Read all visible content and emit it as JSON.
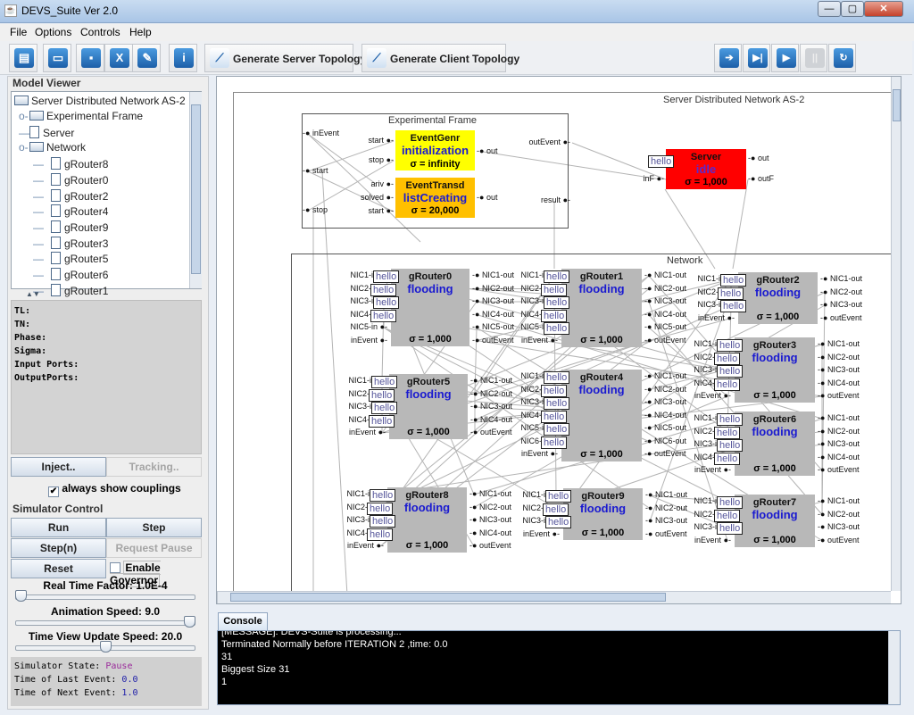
{
  "window": {
    "title": "DEVS_Suite Ver 2.0",
    "controls": [
      "—",
      "▢",
      "✕"
    ]
  },
  "menu": [
    "File",
    "Options",
    "Controls",
    "Help"
  ],
  "toolbar": {
    "icon_buttons": [
      {
        "icon": "new-document-icon",
        "glyph": "▤"
      },
      {
        "icon": "open-folder-icon",
        "glyph": "▭"
      },
      {
        "icon": "save-icon",
        "glyph": "▪"
      },
      {
        "icon": "export-icon",
        "glyph": "X"
      },
      {
        "icon": "wrench-icon",
        "glyph": "✎"
      },
      {
        "icon": "info-bubble-icon",
        "glyph": "i"
      }
    ],
    "generate_server": "Generate Server Topology",
    "generate_client": "Generate Client Topology",
    "sim_buttons": [
      {
        "icon": "step-arrow-icon",
        "glyph": "➔",
        "enabled": true
      },
      {
        "icon": "step-end-icon",
        "glyph": "▶|",
        "enabled": true
      },
      {
        "icon": "play-icon",
        "glyph": "▶",
        "enabled": true
      },
      {
        "icon": "pause-icon",
        "glyph": "||",
        "enabled": false
      },
      {
        "icon": "reset-icon",
        "glyph": "↻",
        "enabled": true
      }
    ]
  },
  "model_viewer": {
    "title": "Model Viewer",
    "root": "Server Distributed Network AS-2",
    "nodes": [
      {
        "label": "Experimental Frame",
        "type": "folder",
        "level": 1
      },
      {
        "label": "Server",
        "type": "leaf",
        "level": 1
      },
      {
        "label": "Network",
        "type": "folder",
        "level": 1
      },
      {
        "label": "gRouter8",
        "type": "leaf",
        "level": 2
      },
      {
        "label": "gRouter0",
        "type": "leaf",
        "level": 2
      },
      {
        "label": "gRouter2",
        "type": "leaf",
        "level": 2
      },
      {
        "label": "gRouter4",
        "type": "leaf",
        "level": 2
      },
      {
        "label": "gRouter9",
        "type": "leaf",
        "level": 2
      },
      {
        "label": "gRouter3",
        "type": "leaf",
        "level": 2
      },
      {
        "label": "gRouter5",
        "type": "leaf",
        "level": 2
      },
      {
        "label": "gRouter6",
        "type": "leaf",
        "level": 2
      },
      {
        "label": "gRouter1",
        "type": "leaf",
        "level": 2
      }
    ]
  },
  "info": [
    "TL:",
    "TN:",
    "Phase:",
    "Sigma:",
    "Input Ports:",
    "OutputPorts:"
  ],
  "inject": "Inject..",
  "tracking": "Tracking..",
  "always_show_couplings": {
    "label": "always show couplings",
    "checked": true
  },
  "sim_control": {
    "title": "Simulator Control",
    "run": "Run",
    "step": "Step",
    "step_n": "Step(n)",
    "request_pause": "Request Pause",
    "reset": "Reset",
    "enable_governor": {
      "label": "Enable Governor",
      "checked": false
    },
    "sliders": [
      {
        "label": "Real Time Factor: 1.0E-4",
        "fraction": 0.0
      },
      {
        "label": "Animation Speed: 9.0",
        "fraction": 1.0
      },
      {
        "label": "Time View Update Speed: 20.0",
        "fraction": 0.5
      }
    ],
    "state": {
      "state_label": "Simulator State:",
      "state_value": "Pause",
      "last_label": "Time of Last Event:",
      "last_value": "0.0",
      "next_label": "Time of Next Event:",
      "next_value": "1.0"
    }
  },
  "diagram": {
    "title": "Server Distributed Network AS-2",
    "ef": {
      "title": "Experimental Frame",
      "in_ports": [
        "inEvent",
        "start",
        "stop"
      ],
      "out_ports": [
        "outEvent",
        "result"
      ],
      "genr": {
        "name": "EventGenr",
        "phase": "initialization",
        "sigma": "σ = infinity",
        "in": [
          "start",
          "stop"
        ],
        "out": [
          "out"
        ],
        "color": "#ffff00"
      },
      "transd": {
        "name": "EventTransd",
        "phase": "listCreating",
        "sigma": "σ = 20,000",
        "in": [
          "ariv",
          "solved",
          "start"
        ],
        "out": [
          "out"
        ],
        "color": "#ffc000"
      }
    },
    "server": {
      "name": "Server",
      "phase": "idle",
      "sigma": "σ = 1,000",
      "in": [
        "inF"
      ],
      "out": [
        "out",
        "outF"
      ],
      "color": "#ff0000",
      "message": "hello"
    },
    "network": {
      "title": "Network"
    },
    "message": "hello",
    "routers": [
      {
        "name": "gRouter0",
        "phase": "flooding",
        "sigma": "σ = 1,000",
        "nics": 5,
        "hellos": 4
      },
      {
        "name": "gRouter1",
        "phase": "flooding",
        "sigma": "σ = 1,000",
        "nics": 5,
        "hellos": 5
      },
      {
        "name": "gRouter2",
        "phase": "flooding",
        "sigma": "σ = 1,000",
        "nics": 3,
        "hellos": 3
      },
      {
        "name": "gRouter3",
        "phase": "flooding",
        "sigma": "σ = 1,000",
        "nics": 4,
        "hellos": 4
      },
      {
        "name": "gRouter5",
        "phase": "flooding",
        "sigma": "σ = 1,000",
        "nics": 4,
        "hellos": 4
      },
      {
        "name": "gRouter4",
        "phase": "flooding",
        "sigma": "σ = 1,000",
        "nics": 6,
        "hellos": 6
      },
      {
        "name": "gRouter6",
        "phase": "flooding",
        "sigma": "σ = 1,000",
        "nics": 4,
        "hellos": 4
      },
      {
        "name": "gRouter8",
        "phase": "flooding",
        "sigma": "σ = 1,000",
        "nics": 4,
        "hellos": 4
      },
      {
        "name": "gRouter9",
        "phase": "flooding",
        "sigma": "σ = 1,000",
        "nics": 3,
        "hellos": 3
      },
      {
        "name": "gRouter7",
        "phase": "flooding",
        "sigma": "σ = 1,000",
        "nics": 3,
        "hellos": 3
      }
    ]
  },
  "console": {
    "tab": "Console",
    "lines": [
      "[MESSAGE]: DEVS-Suite is processing...",
      "Terminated Normally before ITERATION 2 ,time: 0.0",
      "31",
      "Biggest Size 31",
      "1"
    ]
  }
}
